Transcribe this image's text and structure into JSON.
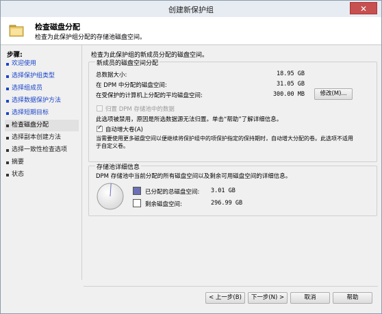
{
  "window": {
    "title": "创建新保护组",
    "close_glyph": "✕"
  },
  "header": {
    "title": "检查磁盘分配",
    "subtitle": "检查为此保护组分配的存储池磁盘空间。",
    "icon": "folder-icon"
  },
  "steps": {
    "title": "步骤:",
    "items": [
      {
        "label": "欢迎使用"
      },
      {
        "label": "选择保护组类型"
      },
      {
        "label": "选择组成员"
      },
      {
        "label": "选择数据保护方法"
      },
      {
        "label": "选择短期目标"
      },
      {
        "label": "检查磁盘分配"
      },
      {
        "label": "选择副本创建方法"
      },
      {
        "label": "选择一致性检查选项"
      },
      {
        "label": "摘要"
      },
      {
        "label": "状态"
      }
    ]
  },
  "main": {
    "intro": "检查为此保护组的新成员分配的磁盘空间。",
    "new_members": {
      "group_title": "新成员的磁盘空间分配",
      "total_label": "总数据大小:",
      "total_value": "18.95 GB",
      "dpm_label": "在 DPM 中分配的磁盘空间:",
      "dpm_value": "31.05 GB",
      "protected_label": "在受保护的计算机上分配的平均磁盘空间:",
      "protected_value": "300.00 MB",
      "modify_button": "修改(M)...",
      "colocate_label": "归置 DPM 存储池中的数据",
      "colocate_note": "此选项被禁用，原因是所选数据源无法归置。单击“帮助”了解详细信息。",
      "autogrow_label": "自动增大卷(A)",
      "autogrow_desc_1": "当需要使用更多磁盘空间以便继续将保护组中的项保护指定的保持期时，自动增大分配的卷。此选项不适用",
      "autogrow_desc_2": "于自定义卷。"
    },
    "storage_pool": {
      "group_title": "存储池详细信息",
      "desc": "DPM 存储池中当前分配的所有磁盘空间以及剩余可用磁盘空间的详细信息。",
      "allocated_label": "已分配的总磁盘空间:",
      "allocated_value": "3.01 GB",
      "free_label": "剩余磁盘空间:",
      "free_value": "296.99 GB",
      "allocated_fraction": 0.01,
      "allocated_color": "#6b6fb5"
    }
  },
  "footer": {
    "back_button": "< 上一步(B)",
    "next_button": "下一步(N) >",
    "cancel_button": "取消",
    "help_button": "帮助"
  }
}
